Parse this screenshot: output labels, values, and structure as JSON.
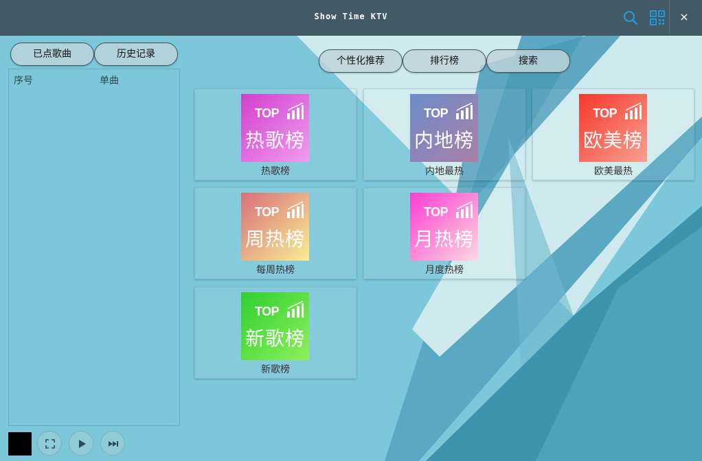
{
  "window": {
    "title": "Show Time KTV"
  },
  "titlebar": {
    "search_icon": "search-icon",
    "qr_icon": "qr-code-icon",
    "close_label": "×"
  },
  "sidebar": {
    "tabs": [
      {
        "label": "已点歌曲"
      },
      {
        "label": "历史记录"
      }
    ],
    "playlist": {
      "columns": [
        "序号",
        "单曲"
      ],
      "rows": []
    }
  },
  "nav": {
    "tabs": [
      {
        "label": "个性化推荐"
      },
      {
        "label": "排行榜"
      },
      {
        "label": "搜索"
      }
    ]
  },
  "charts": [
    {
      "top": "TOP",
      "cover_title": "热歌榜",
      "caption": "热歌榜",
      "gradient": [
        "#d33fce",
        "#f09cf0"
      ]
    },
    {
      "top": "TOP",
      "cover_title": "内地榜",
      "caption": "内地最热",
      "gradient": [
        "#6c8cc9",
        "#a97fa6"
      ]
    },
    {
      "top": "TOP",
      "cover_title": "欧美榜",
      "caption": "欧美最热",
      "gradient": [
        "#f5372c",
        "#f9a08f"
      ]
    },
    {
      "top": "TOP",
      "cover_title": "周热榜",
      "caption": "每周热榜",
      "gradient": [
        "#d9707a",
        "#f8ee92"
      ]
    },
    {
      "top": "TOP",
      "cover_title": "月热榜",
      "caption": "月度热榜",
      "gradient": [
        "#fb3ed3",
        "#fdd8df"
      ]
    },
    {
      "top": "TOP",
      "cover_title": "新歌榜",
      "caption": "新歌榜",
      "gradient": [
        "#2fcf31",
        "#8ef05a"
      ]
    }
  ],
  "player": {
    "controls": [
      "fullscreen-icon",
      "play-icon",
      "skip-next-icon"
    ]
  },
  "colors": {
    "titlebar": "#435a66",
    "accent": "#1e9ad6",
    "background": "#79c6d8"
  }
}
